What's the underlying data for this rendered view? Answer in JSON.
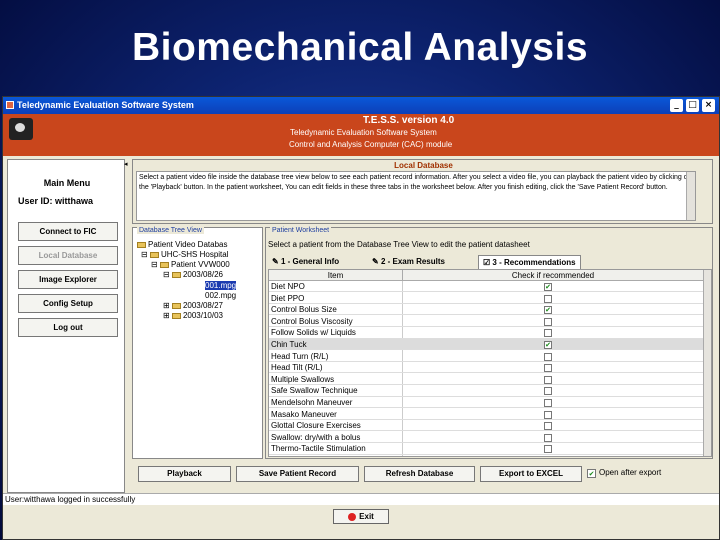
{
  "slide": {
    "title": "Biomechanical Analysis"
  },
  "window": {
    "title": "Teledynamic Evaluation Software System"
  },
  "banner": {
    "line1": "T.E.S.S. version 4.0",
    "line2": "Teledynamic Evaluation Software System",
    "line3": "Control and Analysis Computer (CAC) module"
  },
  "menu": {
    "title": "Main Menu",
    "user_id": "User ID:  witthawa",
    "buttons": [
      "Connect to FIC",
      "Local Database",
      "Image Explorer",
      "Config Setup",
      "Log out"
    ]
  },
  "local_db": {
    "title": "Local Database",
    "text": "Select a patient video file inside the database tree view below to see each patient record information.  After you select a video file, you can playback the patient video by clicking on the 'Playback' button.  In the patient worksheet, You can edit fields in these three tabs in the worksheet below.  After you finish editing, click the 'Save Patient Record' button."
  },
  "tree": {
    "title": "Database Tree View",
    "nodes": [
      "Patient Video Databas",
      "UHC-SHS Hospital",
      "Patient VVW000",
      "2003/08/26",
      "001.mpg",
      "002.mpg",
      "2003/08/27",
      "2003/10/03"
    ]
  },
  "worksheet": {
    "title": "Patient Worksheet",
    "subtitle": "Select a patient from the Database Tree View to edit the patient datasheet",
    "tabs": [
      "1 - General Info",
      "2 - Exam Results",
      "3 - Recommendations"
    ],
    "col_item": "Item",
    "col_check": "Check if recommended",
    "rows": [
      {
        "name": "Diet NPO",
        "checked": true
      },
      {
        "name": "Diet PPO",
        "checked": false
      },
      {
        "name": "Control Bolus Size",
        "checked": true
      },
      {
        "name": "Control Bolus Viscosity",
        "checked": false
      },
      {
        "name": "Follow Solids w/ Liquids",
        "checked": false
      },
      {
        "name": "Chin Tuck",
        "checked": true
      },
      {
        "name": "Head Turn (R/L)",
        "checked": false
      },
      {
        "name": "Head Tilt (R/L)",
        "checked": false
      },
      {
        "name": "Multiple Swallows",
        "checked": false
      },
      {
        "name": "Safe Swallow Technique",
        "checked": false
      },
      {
        "name": "Mendelsohn Maneuver",
        "checked": false
      },
      {
        "name": "Masako Maneuver",
        "checked": false
      },
      {
        "name": "Glottal Closure Exercises",
        "checked": false
      },
      {
        "name": "Swallow: dry/with a bolus",
        "checked": false
      },
      {
        "name": "Thermo-Tactile Stimulation",
        "checked": false
      }
    ]
  },
  "buttons": {
    "playback": "Playback",
    "save": "Save Patient Record",
    "refresh": "Refresh Database",
    "export": "Export to EXCEL",
    "open_after": "Open after export"
  },
  "status": "User:witthawa logged in successfully",
  "exit": "Exit"
}
